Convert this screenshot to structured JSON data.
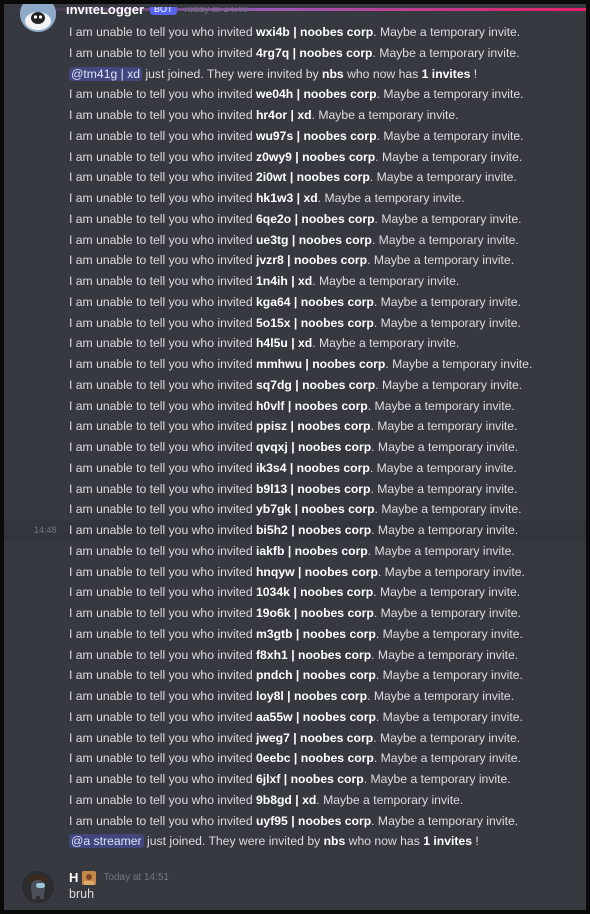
{
  "bot_message": {
    "username": "InviteLogger",
    "badge": "BOT",
    "timestamp": "Today at 14:48",
    "lines": [
      {
        "kind": "invite",
        "code": "wxi4b",
        "sep": " | ",
        "server": "noobes corp"
      },
      {
        "kind": "invite",
        "code": "4rg7q",
        "sep": " | ",
        "server": "noobes corp"
      },
      {
        "kind": "join",
        "mention": "@tm41g | xd",
        "inviter": "nbs",
        "invites": "1 invites"
      },
      {
        "kind": "invite",
        "code": "we04h",
        "sep": " | ",
        "server": "noobes corp"
      },
      {
        "kind": "invite",
        "code": "hr4or",
        "sep": " | ",
        "server": "xd"
      },
      {
        "kind": "invite",
        "code": "wu97s",
        "sep": " | ",
        "server": "noobes corp"
      },
      {
        "kind": "invite",
        "code": "z0wy9",
        "sep": " | ",
        "server": "noobes corp"
      },
      {
        "kind": "invite",
        "code": "2i0wt",
        "sep": " | ",
        "server": "noobes corp"
      },
      {
        "kind": "invite",
        "code": "hk1w3",
        "sep": " | ",
        "server": "xd"
      },
      {
        "kind": "invite",
        "code": "6qe2o",
        "sep": " | ",
        "server": "noobes corp"
      },
      {
        "kind": "invite",
        "code": "ue3tg",
        "sep": " | ",
        "server": "noobes corp"
      },
      {
        "kind": "invite",
        "code": "jvzr8",
        "sep": " | ",
        "server": "noobes corp"
      },
      {
        "kind": "invite",
        "code": "1n4ih",
        "sep": " | ",
        "server": "xd"
      },
      {
        "kind": "invite",
        "code": "kga64",
        "sep": " | ",
        "server": "noobes corp"
      },
      {
        "kind": "invite",
        "code": "5o15x",
        "sep": " | ",
        "server": "noobes corp"
      },
      {
        "kind": "invite",
        "code": "h4l5u",
        "sep": " | ",
        "server": "xd"
      },
      {
        "kind": "invite",
        "code": "mmhwu",
        "sep": " | ",
        "server": "noobes corp"
      },
      {
        "kind": "invite",
        "code": "sq7dg",
        "sep": " | ",
        "server": "noobes corp"
      },
      {
        "kind": "invite",
        "code": "h0vlf",
        "sep": " | ",
        "server": "noobes corp"
      },
      {
        "kind": "invite",
        "code": "ppisz",
        "sep": " | ",
        "server": "noobes corp"
      },
      {
        "kind": "invite",
        "code": "qvqxj",
        "sep": " | ",
        "server": "noobes corp"
      },
      {
        "kind": "invite",
        "code": "ik3s4",
        "sep": " | ",
        "server": "noobes corp"
      },
      {
        "kind": "invite",
        "code": "b9l13",
        "sep": " | ",
        "server": "noobes corp"
      },
      {
        "kind": "invite",
        "code": "yb7gk",
        "sep": " | ",
        "server": "noobes corp"
      },
      {
        "kind": "invite",
        "code": "bi5h2",
        "sep": " | ",
        "server": "noobes corp",
        "hover_time": "14:48"
      },
      {
        "kind": "invite",
        "code": "iakfb",
        "sep": " | ",
        "server": "noobes corp"
      },
      {
        "kind": "invite",
        "code": "hnqyw",
        "sep": " | ",
        "server": "noobes corp"
      },
      {
        "kind": "invite",
        "code": "1034k",
        "sep": " | ",
        "server": "noobes corp"
      },
      {
        "kind": "invite",
        "code": "19o6k",
        "sep": " | ",
        "server": "noobes corp"
      },
      {
        "kind": "invite",
        "code": "m3gtb",
        "sep": " | ",
        "server": "noobes corp"
      },
      {
        "kind": "invite",
        "code": "f8xh1",
        "sep": " | ",
        "server": "noobes corp"
      },
      {
        "kind": "invite",
        "code": "pndch",
        "sep": " | ",
        "server": "noobes corp"
      },
      {
        "kind": "invite",
        "code": "loy8l",
        "sep": " | ",
        "server": "noobes corp"
      },
      {
        "kind": "invite",
        "code": "aa55w",
        "sep": " | ",
        "server": "noobes corp"
      },
      {
        "kind": "invite",
        "code": "jweg7",
        "sep": " | ",
        "server": "noobes corp"
      },
      {
        "kind": "invite",
        "code": "0eebc",
        "sep": " | ",
        "server": "noobes corp"
      },
      {
        "kind": "invite",
        "code": "6jlxf",
        "sep": " | ",
        "server": "noobes corp"
      },
      {
        "kind": "invite",
        "code": "9b8gd",
        "sep": " | ",
        "server": "xd"
      },
      {
        "kind": "invite",
        "code": "uyf95",
        "sep": " | ",
        "server": "noobes corp"
      },
      {
        "kind": "join",
        "mention": "@a streamer",
        "inviter": "nbs",
        "invites": "1 invites"
      }
    ]
  },
  "phrases": {
    "invite_prefix": "I am unable to tell you who invited ",
    "invite_suffix": ". Maybe a temporary invite.",
    "join_mid": " just joined. They were invited by ",
    "join_mid2": " who now has ",
    "join_end": " !"
  },
  "user_message": {
    "username": "H",
    "timestamp": "Today at 14:51",
    "text": "bruh"
  },
  "colors": {
    "background": "#36393f",
    "mention_bg": "#4e5aa8",
    "accent": "#9b59b6"
  }
}
